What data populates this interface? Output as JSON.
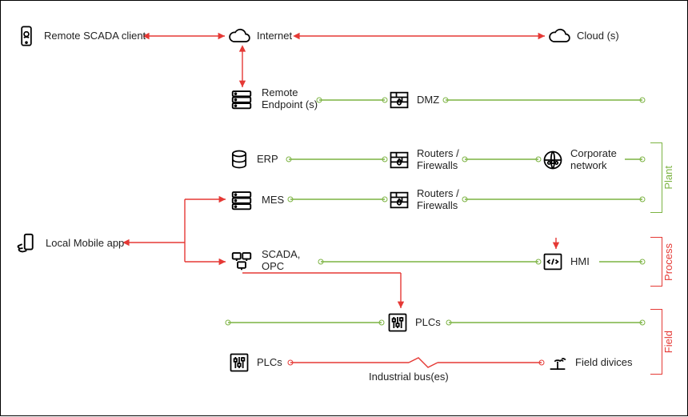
{
  "nodes": {
    "remote_client": "Remote SCADA client",
    "internet": "Internet",
    "cloud": "Cloud (s)",
    "remote_ep": "Remote\nEndpoint (s)",
    "dmz": "DMZ",
    "erp": "ERP",
    "routers1": "Routers /\nFirewalls",
    "corpnet": "Corporate\nnetwork",
    "mes": "MES",
    "routers2": "Routers /\nFirewalls",
    "local_app": "Local Mobile app",
    "scada_opc": "SCADA,\nOPC",
    "hmi": "HMI",
    "plcs_a": "PLCs",
    "plcs_b": "PLCs",
    "field_dev": "Field divices",
    "bus": "Industrial bus(es)"
  },
  "zones": {
    "plant": "Plant",
    "process": "Process",
    "field": "Field"
  },
  "colors": {
    "red": "#E53935",
    "green": "#7CB342"
  }
}
